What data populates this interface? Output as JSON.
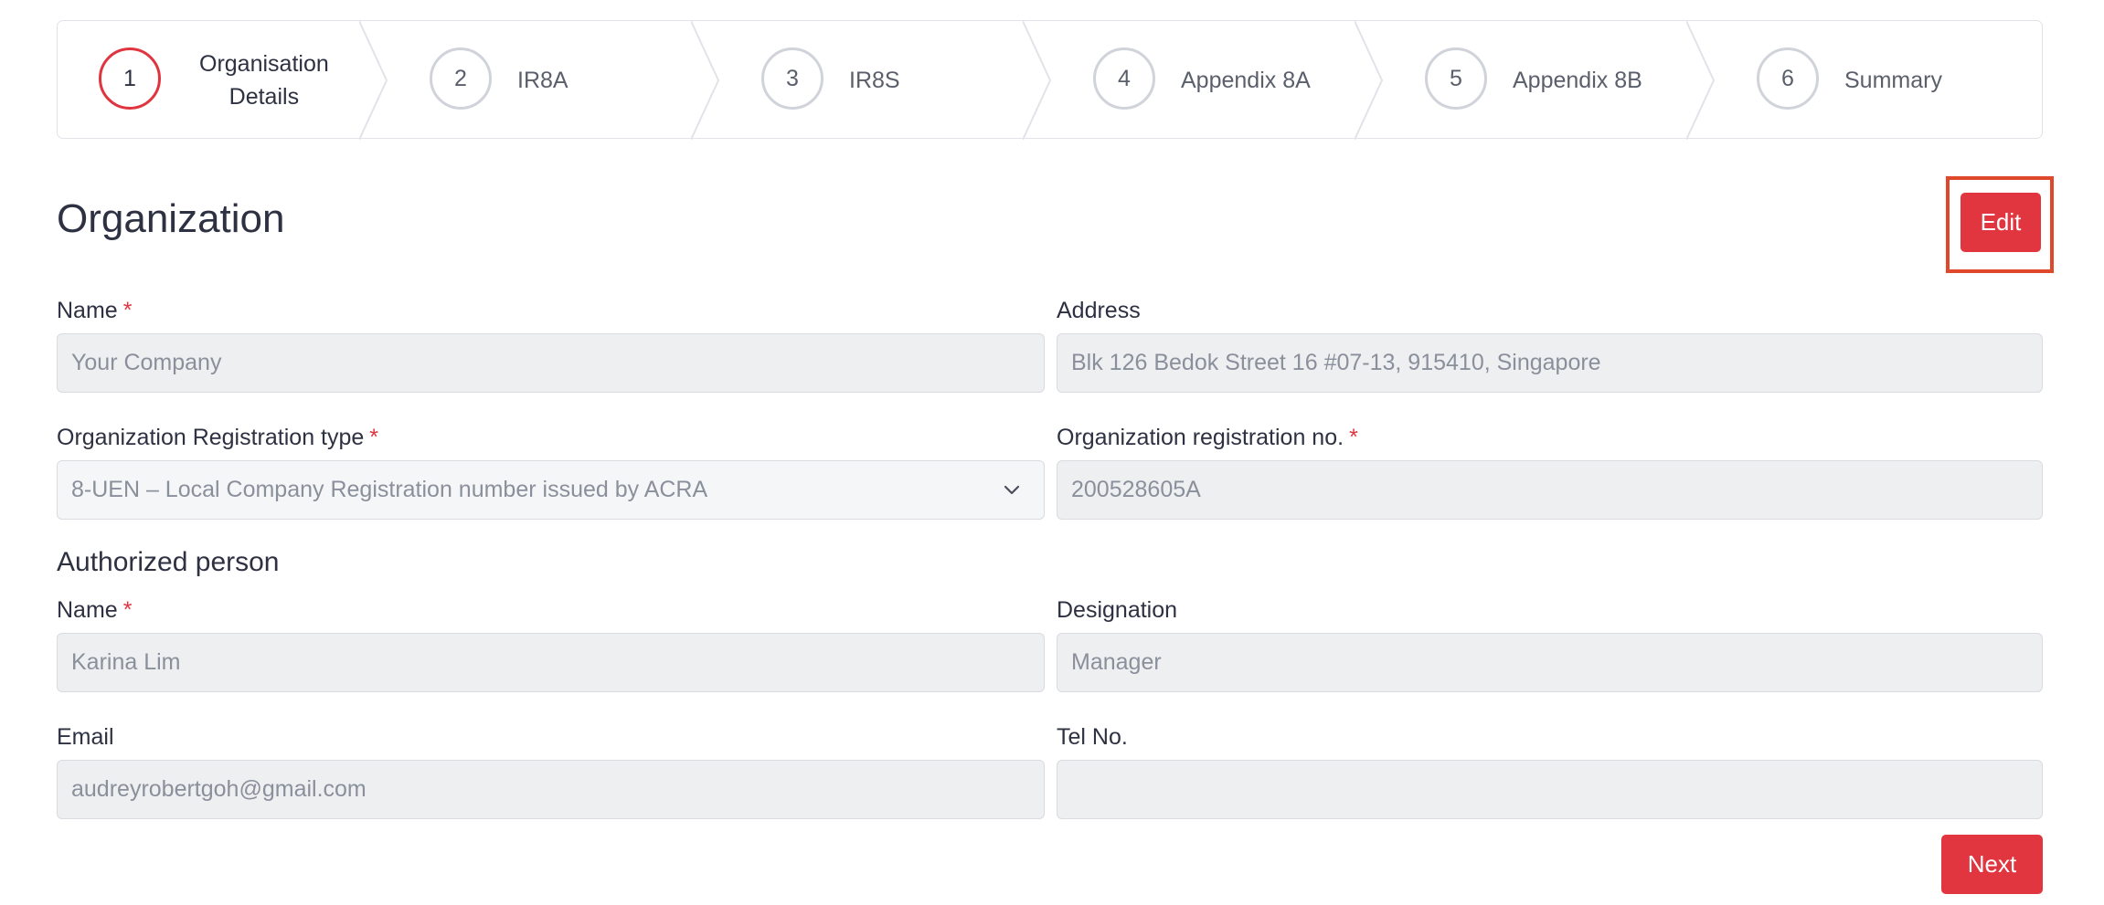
{
  "stepper": {
    "steps": [
      {
        "number": "1",
        "label": "Organisation Details",
        "label_line1": "Organisation",
        "label_line2": "Details",
        "active": true
      },
      {
        "number": "2",
        "label": "IR8A",
        "active": false
      },
      {
        "number": "3",
        "label": "IR8S",
        "active": false
      },
      {
        "number": "4",
        "label": "Appendix 8A",
        "active": false
      },
      {
        "number": "5",
        "label": "Appendix 8B",
        "active": false
      },
      {
        "number": "6",
        "label": "Summary",
        "active": false
      }
    ]
  },
  "page": {
    "title": "Organization",
    "edit_label": "Edit",
    "next_label": "Next"
  },
  "organization": {
    "name_label": "Name",
    "name_value": "Your Company",
    "address_label": "Address",
    "address_value": "Blk 126 Bedok Street 16 #07-13, 915410, Singapore",
    "reg_type_label": "Organization Registration type",
    "reg_type_value": "8-UEN – Local Company Registration number issued by ACRA",
    "reg_no_label": "Organization registration no.",
    "reg_no_value": "200528605A"
  },
  "authorized_person": {
    "section_title": "Authorized person",
    "name_label": "Name",
    "name_value": "Karina Lim",
    "designation_label": "Designation",
    "designation_value": "Manager",
    "email_label": "Email",
    "email_value": "audreyrobertgoh@gmail.com",
    "tel_label": "Tel No.",
    "tel_value": ""
  },
  "required_marker": "*",
  "colors": {
    "accent_red": "#e1353f",
    "highlight_border": "#e0482c",
    "input_bg": "#eeeff1",
    "text_dark": "#2d3142",
    "text_muted": "#8a909b"
  }
}
